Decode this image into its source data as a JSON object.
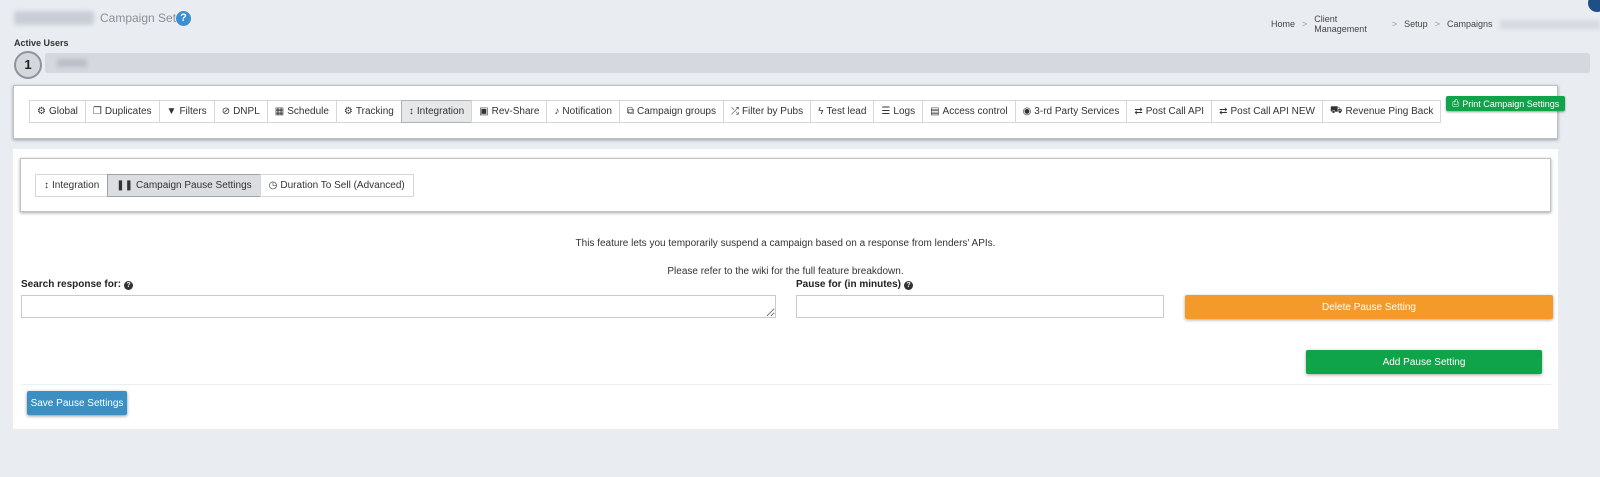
{
  "header": {
    "page_title": "Campaign Setup",
    "help_icon_glyph": "?",
    "breadcrumb": [
      "Home",
      "Client Management",
      "Setup",
      "Campaigns"
    ],
    "breadcrumb_separator": ">"
  },
  "active_users": {
    "label": "Active Users",
    "count": "1"
  },
  "main_tabs": [
    {
      "label": "Global",
      "icon": "cogs-icon",
      "glyph": "⚙"
    },
    {
      "label": "Duplicates",
      "icon": "copy-icon",
      "glyph": "❐"
    },
    {
      "label": "Filters",
      "icon": "filter-icon",
      "glyph": "▼"
    },
    {
      "label": "DNPL",
      "icon": "ban-icon",
      "glyph": "⊘"
    },
    {
      "label": "Schedule",
      "icon": "calendar-icon",
      "glyph": "▦"
    },
    {
      "label": "Tracking",
      "icon": "cogs-icon",
      "glyph": "⚙"
    },
    {
      "label": "Integration",
      "icon": "arrows-vertical-icon",
      "glyph": "↕",
      "active": true
    },
    {
      "label": "Rev-Share",
      "icon": "money-icon",
      "glyph": "▣"
    },
    {
      "label": "Notification",
      "icon": "bell-icon",
      "glyph": "♪"
    },
    {
      "label": "Campaign groups",
      "icon": "object-group-icon",
      "glyph": "⧉"
    },
    {
      "label": "Filter by Pubs",
      "icon": "random-icon",
      "glyph": "⤮"
    },
    {
      "label": "Test lead",
      "icon": "bolt-icon",
      "glyph": "ϟ"
    },
    {
      "label": "Logs",
      "icon": "list-icon",
      "glyph": "☰"
    },
    {
      "label": "Access control",
      "icon": "file-icon",
      "glyph": "▤"
    },
    {
      "label": "3-rd Party Services",
      "icon": "eye-icon",
      "glyph": "◉"
    },
    {
      "label": "Post Call API",
      "icon": "exchange-icon",
      "glyph": "⇄"
    },
    {
      "label": "Post Call API NEW",
      "icon": "exchange-icon",
      "glyph": "⇄"
    },
    {
      "label": "Revenue Ping Back",
      "icon": "cart-icon",
      "glyph": "⛟"
    }
  ],
  "print_button": {
    "label": "Print Campaign Settings",
    "glyph": "⎙"
  },
  "sub_tabs": [
    {
      "label": "Integration",
      "icon": "arrows-vertical-icon",
      "glyph": "↕"
    },
    {
      "label": "Campaign Pause Settings",
      "icon": "pause-icon",
      "glyph": "❚❚",
      "active": true
    },
    {
      "label": "Duration To Sell (Advanced)",
      "icon": "clock-icon",
      "glyph": "◷"
    }
  ],
  "pause_settings": {
    "info_line1": "This feature lets you temporarily suspend a campaign based on a response from lenders' APIs.",
    "info_line2": "Please refer to the wiki for the full feature breakdown.",
    "search_label": "Search response for:",
    "search_value": "",
    "pause_label": "Pause for (in minutes)",
    "pause_value": "",
    "delete_label": "Delete Pause Setting",
    "add_label": "Add Pause Setting",
    "save_label": "Save Pause Settings"
  },
  "colors": {
    "page_bg": "#e9edf2",
    "primary_blue": "#3b8fc2",
    "success_green": "#0fa34a",
    "warning_orange": "#f39a2b"
  }
}
